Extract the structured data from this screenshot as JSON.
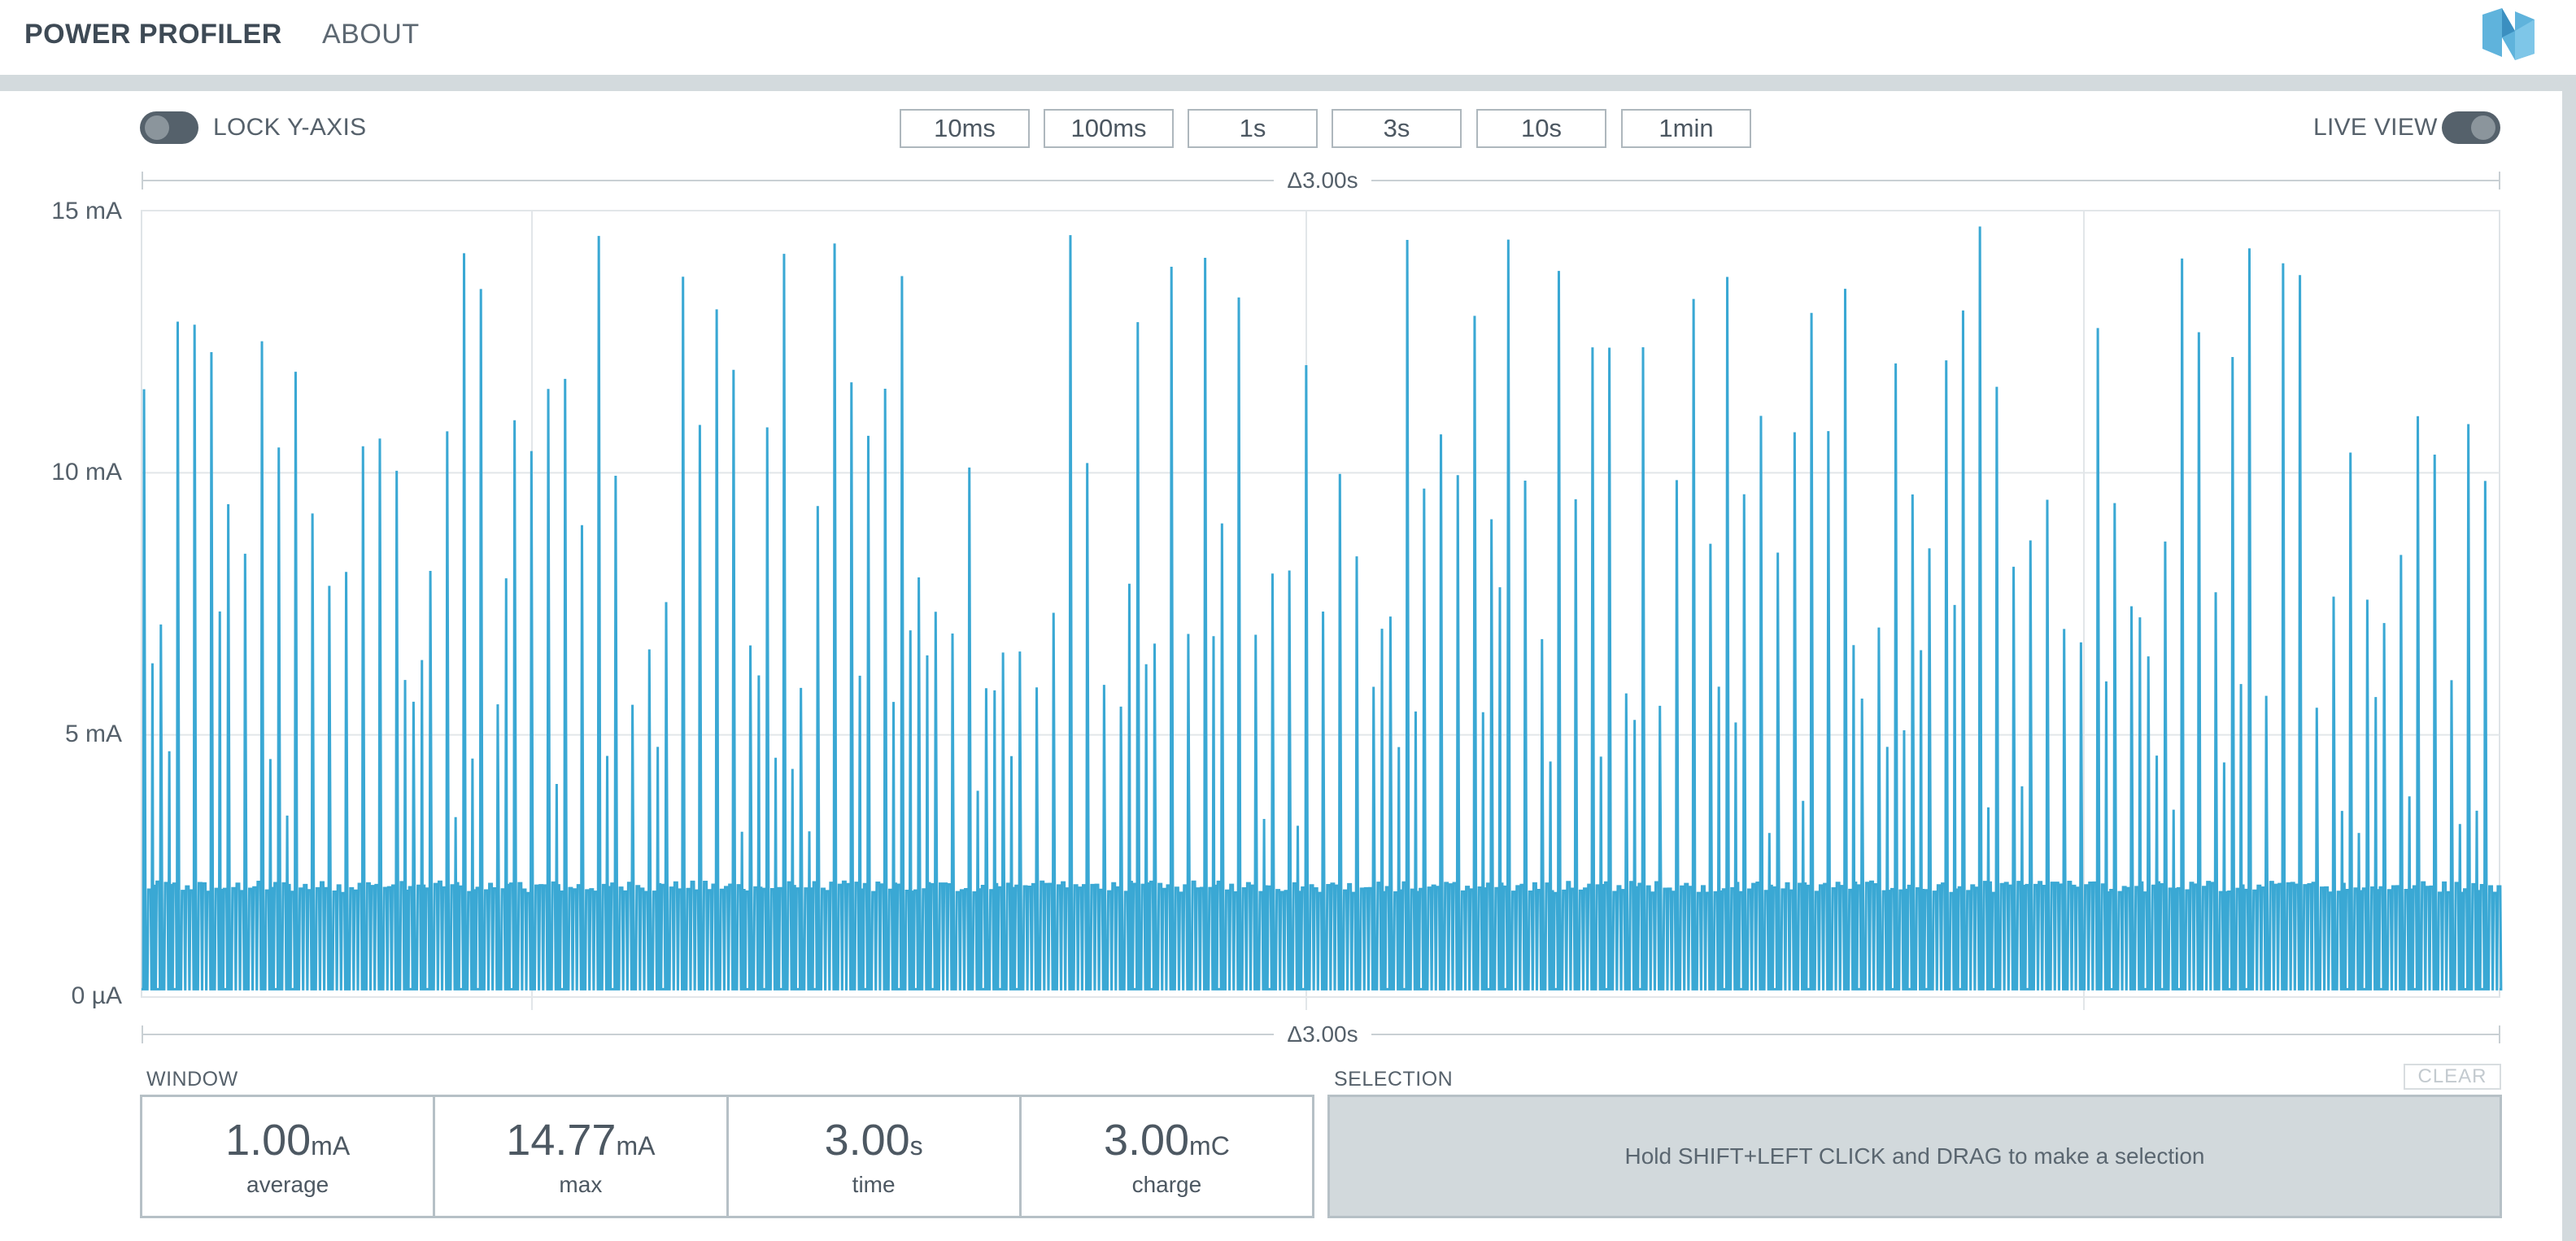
{
  "nav": {
    "items": [
      {
        "label": "POWER PROFILER",
        "active": true
      },
      {
        "label": "ABOUT",
        "active": false
      }
    ],
    "logo_icon": "nordic-logo-icon"
  },
  "controls": {
    "lock_y_axis": {
      "label": "LOCK Y-AXIS",
      "on": false
    },
    "live_view": {
      "label": "LIVE VIEW",
      "on": false
    },
    "zoom_buttons": [
      "10ms",
      "100ms",
      "1s",
      "3s",
      "10s",
      "1min"
    ]
  },
  "window_delta": {
    "top_label": "Δ3.00s",
    "bottom_label": "Δ3.00s"
  },
  "chart_data": {
    "type": "line",
    "series": [
      {
        "color": "#3aa8d4"
      }
    ],
    "y_ticks": [
      "15 mA",
      "10 mA",
      "5 mA",
      "0 µA"
    ],
    "y_tick_values": [
      15,
      10,
      5,
      0
    ],
    "ylim": [
      0,
      15
    ],
    "y_unit": "mA",
    "x_span_seconds": 3.0,
    "baseline_mA": 0.15,
    "sleep_pulse_mA": 2.2,
    "spike_count": 140,
    "spike_peak_range_mA": [
      5.5,
      14.8
    ],
    "grid": true
  },
  "window_stats": {
    "title": "WINDOW",
    "items": [
      {
        "value": "1.00",
        "unit": "mA",
        "caption": "average"
      },
      {
        "value": "14.77",
        "unit": "mA",
        "caption": "max"
      },
      {
        "value": "3.00",
        "unit": "s",
        "caption": "time"
      },
      {
        "value": "3.00",
        "unit": "mC",
        "caption": "charge"
      }
    ]
  },
  "selection": {
    "title": "SELECTION",
    "clear_label": "CLEAR",
    "hint": "Hold SHIFT+LEFT CLICK and DRAG to make a selection"
  },
  "colors": {
    "accent": "#3aa8d4",
    "toggle": "#55616b",
    "frame": "#d3dadd",
    "selection_bg": "#d2d9dc"
  }
}
